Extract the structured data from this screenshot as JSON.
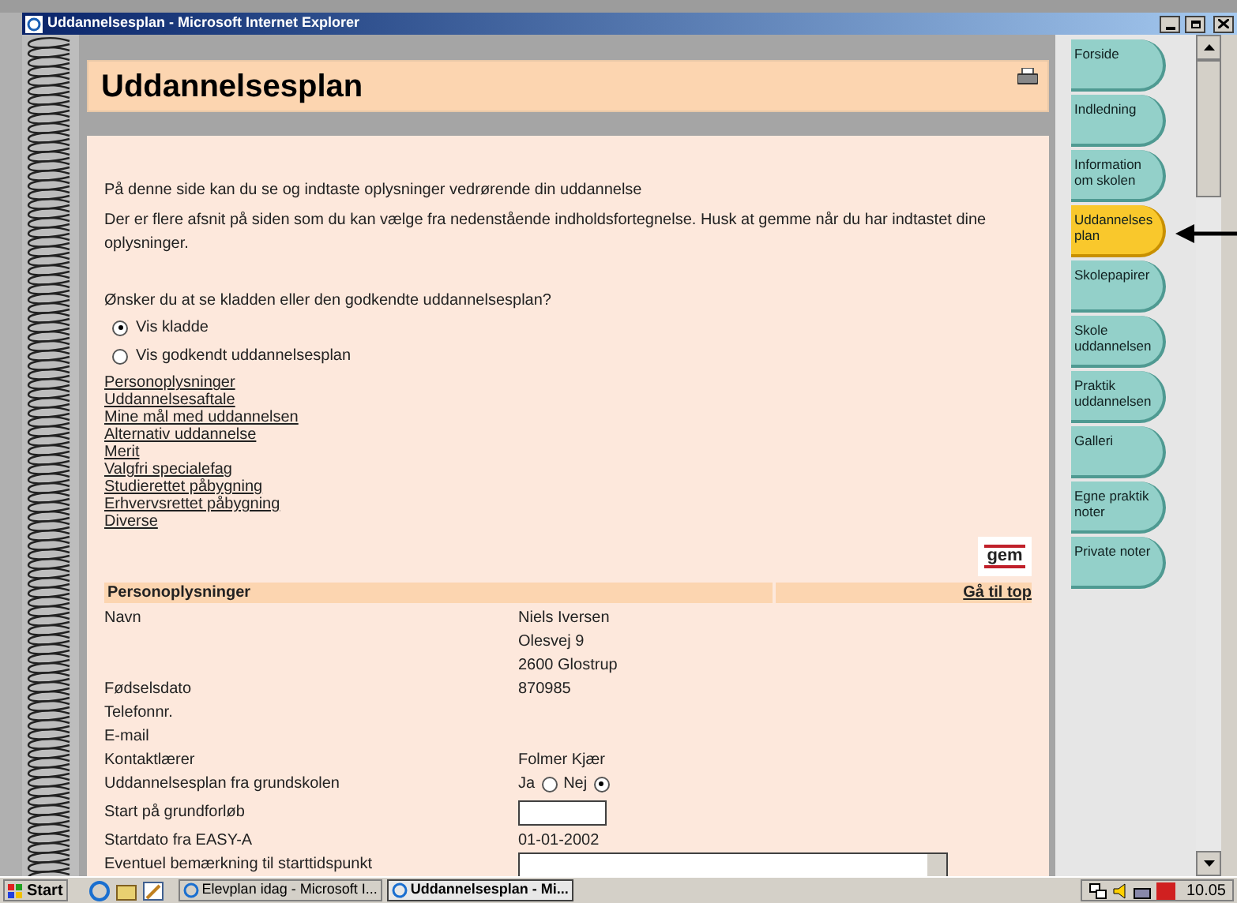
{
  "window": {
    "title": "Uddannelsesplan - Microsoft Internet Explorer"
  },
  "page": {
    "title": "Uddannelsesplan",
    "intro": [
      "På denne side kan du se og indtaste oplysninger vedrørende din uddannelse",
      "Der er flere afsnit på siden som du kan vælge fra nedenstående indholdsfortegnelse. Husk at gemme når du har indtastet dine oplysninger."
    ],
    "question": "Ønsker du at se kladden eller den godkendte uddannelsesplan?",
    "view_options": [
      {
        "label": "Vis kladde",
        "selected": true
      },
      {
        "label": "Vis godkendt uddannelsesplan",
        "selected": false
      }
    ],
    "contents": [
      "Personoplysninger",
      "Uddannelsesaftale",
      "Mine mål med uddannelsen",
      "Alternativ uddannelse",
      "Merit",
      "Valgfri specialefag",
      "Studierettet påbygning",
      "Erhvervsrettet påbygning",
      "Diverse"
    ],
    "logo": "gem",
    "section": {
      "heading": "Personoplysninger",
      "top_link": "Gå til top",
      "rows": [
        {
          "kind": "text",
          "label": "Navn",
          "value": "Niels Iversen"
        },
        {
          "kind": "text",
          "label": "",
          "value": "Olesvej 9"
        },
        {
          "kind": "text",
          "label": "",
          "value": "2600 Glostrup"
        },
        {
          "kind": "text",
          "label": "Fødselsdato",
          "value": "870985"
        },
        {
          "kind": "text",
          "label": "Telefonnr.",
          "value": ""
        },
        {
          "kind": "text",
          "label": "E-mail",
          "value": ""
        },
        {
          "kind": "text",
          "label": "Kontaktlærer",
          "value": "Folmer Kjær"
        },
        {
          "kind": "radio",
          "label": "Uddannelsesplan fra grundskolen",
          "options": [
            {
              "label": "Ja",
              "selected": false
            },
            {
              "label": "Nej",
              "selected": true
            }
          ]
        },
        {
          "kind": "input",
          "label": "Start på grundforløb"
        },
        {
          "kind": "text",
          "label": "Startdato fra EASY-A",
          "value": "01-01-2002"
        },
        {
          "kind": "select",
          "label": "Eventuel bemærkning til starttidspunkt"
        }
      ]
    }
  },
  "nav": [
    {
      "label": "Forside",
      "selected": false
    },
    {
      "label": "Indledning",
      "selected": false
    },
    {
      "label": "Information om skolen",
      "selected": false
    },
    {
      "label": "Uddannelses plan",
      "selected": true
    },
    {
      "label": "Skolepapirer",
      "selected": false
    },
    {
      "label": "Skole uddannelsen",
      "selected": false
    },
    {
      "label": "Praktik uddannelsen",
      "selected": false
    },
    {
      "label": "Galleri",
      "selected": false
    },
    {
      "label": "Egne praktik noter",
      "selected": false
    },
    {
      "label": "Private noter",
      "selected": false
    }
  ],
  "taskbar": {
    "start": "Start",
    "tasks": [
      {
        "label": "Elevplan idag - Microsoft I...",
        "selected": false
      },
      {
        "label": "Uddannelsesplan - Mi...",
        "selected": true
      }
    ],
    "clock": "10.05"
  }
}
